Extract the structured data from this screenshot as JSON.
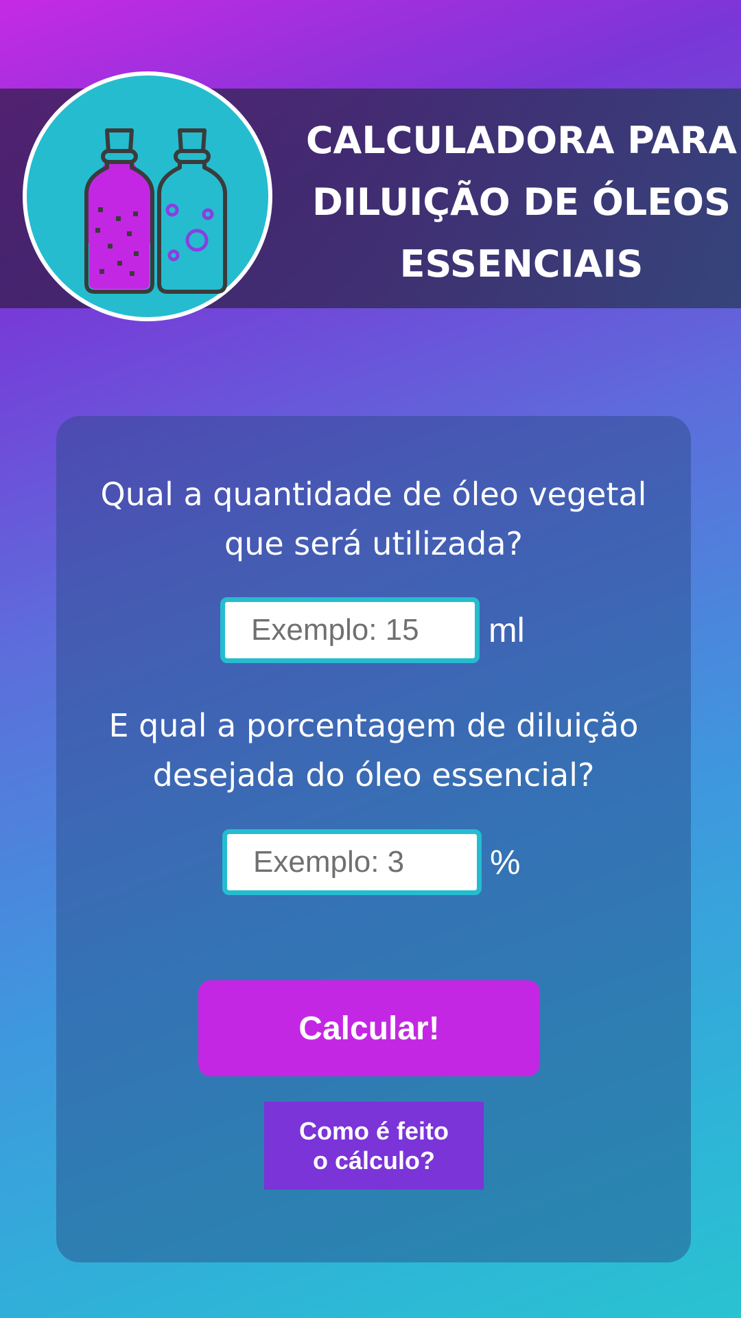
{
  "header": {
    "title_lines": [
      "CALCULADORA PARA",
      "DILUIÇÃO DE ÓLEOS",
      "ESSENCIAIS"
    ],
    "logo_icon": "essential-oil-bottles-icon"
  },
  "form": {
    "question1_lines": [
      "Qual a quantidade de óleo vegetal",
      "que será utilizada?"
    ],
    "input1_placeholder": "Exemplo: 15",
    "input1_unit": "ml",
    "question2_lines": [
      "E qual a porcentagem de diluição",
      "desejada do óleo essencial?"
    ],
    "input2_placeholder": "Exemplo: 3",
    "input2_unit": "%"
  },
  "buttons": {
    "calculate_label": "Calcular!",
    "how_lines": [
      "Como é feito",
      "o cálculo?"
    ]
  },
  "colors": {
    "accent_magenta": "#c427e3",
    "accent_purple": "#7a34d8",
    "accent_teal": "#25bccf"
  }
}
